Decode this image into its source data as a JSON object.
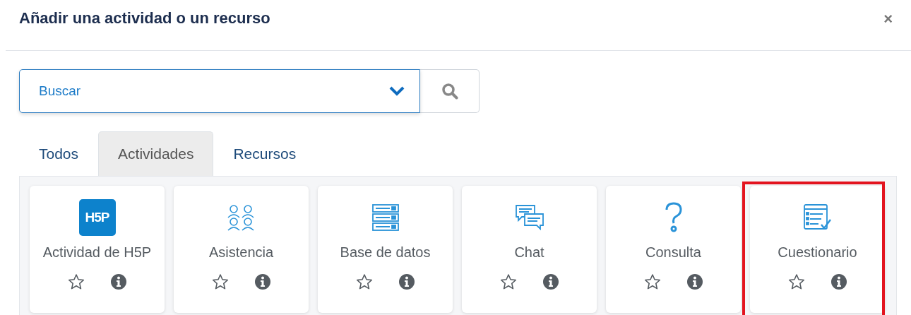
{
  "dialog": {
    "title": "Añadir una actividad o un recurso",
    "close": "×"
  },
  "search": {
    "placeholder": "Buscar"
  },
  "tabs": [
    {
      "label": "Todos",
      "selected": false
    },
    {
      "label": "Actividades",
      "selected": true
    },
    {
      "label": "Recursos",
      "selected": false
    }
  ],
  "items": [
    {
      "kind": "h5p",
      "logo_text": "H5P",
      "label": "Actividad de H5P",
      "starred": false,
      "highlighted": false
    },
    {
      "kind": "people",
      "label": "Asistencia",
      "starred": false,
      "highlighted": false
    },
    {
      "kind": "database",
      "label": "Base de datos",
      "starred": false,
      "highlighted": false
    },
    {
      "kind": "chat",
      "label": "Chat",
      "starred": false,
      "highlighted": false
    },
    {
      "kind": "question",
      "label": "Consulta",
      "starred": false,
      "highlighted": false
    },
    {
      "kind": "quiz",
      "label": "Cuestionario",
      "starred": false,
      "highlighted": true
    }
  ]
}
